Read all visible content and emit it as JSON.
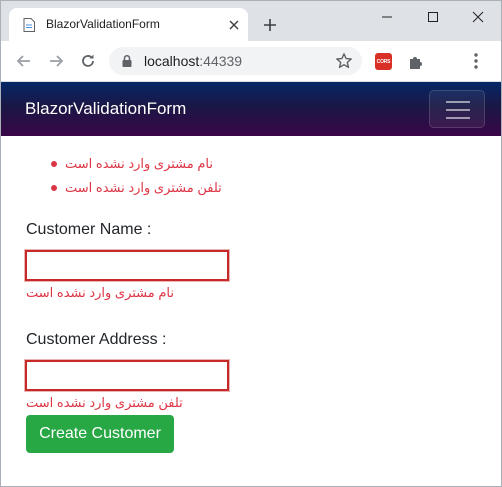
{
  "browser": {
    "tab_title": "BlazorValidationForm",
    "url_host": "localhost",
    "url_port": ":44339",
    "cors_badge": "CORS"
  },
  "app": {
    "brand": "BlazorValidationForm"
  },
  "validation_summary": [
    "نام مشتری وارد نشده است",
    "تلفن مشتری وارد نشده است"
  ],
  "form": {
    "name_label": "Customer Name :",
    "name_value": "",
    "name_error": "نام مشتری وارد نشده است",
    "address_label": "Customer Address :",
    "address_value": "",
    "address_error": "تلفن مشتری وارد نشده است",
    "submit_label": "Create Customer"
  },
  "colors": {
    "error": "#dc3545",
    "success_button": "#28a745",
    "navbar_top": "#052767",
    "navbar_bottom": "#3a0647"
  }
}
